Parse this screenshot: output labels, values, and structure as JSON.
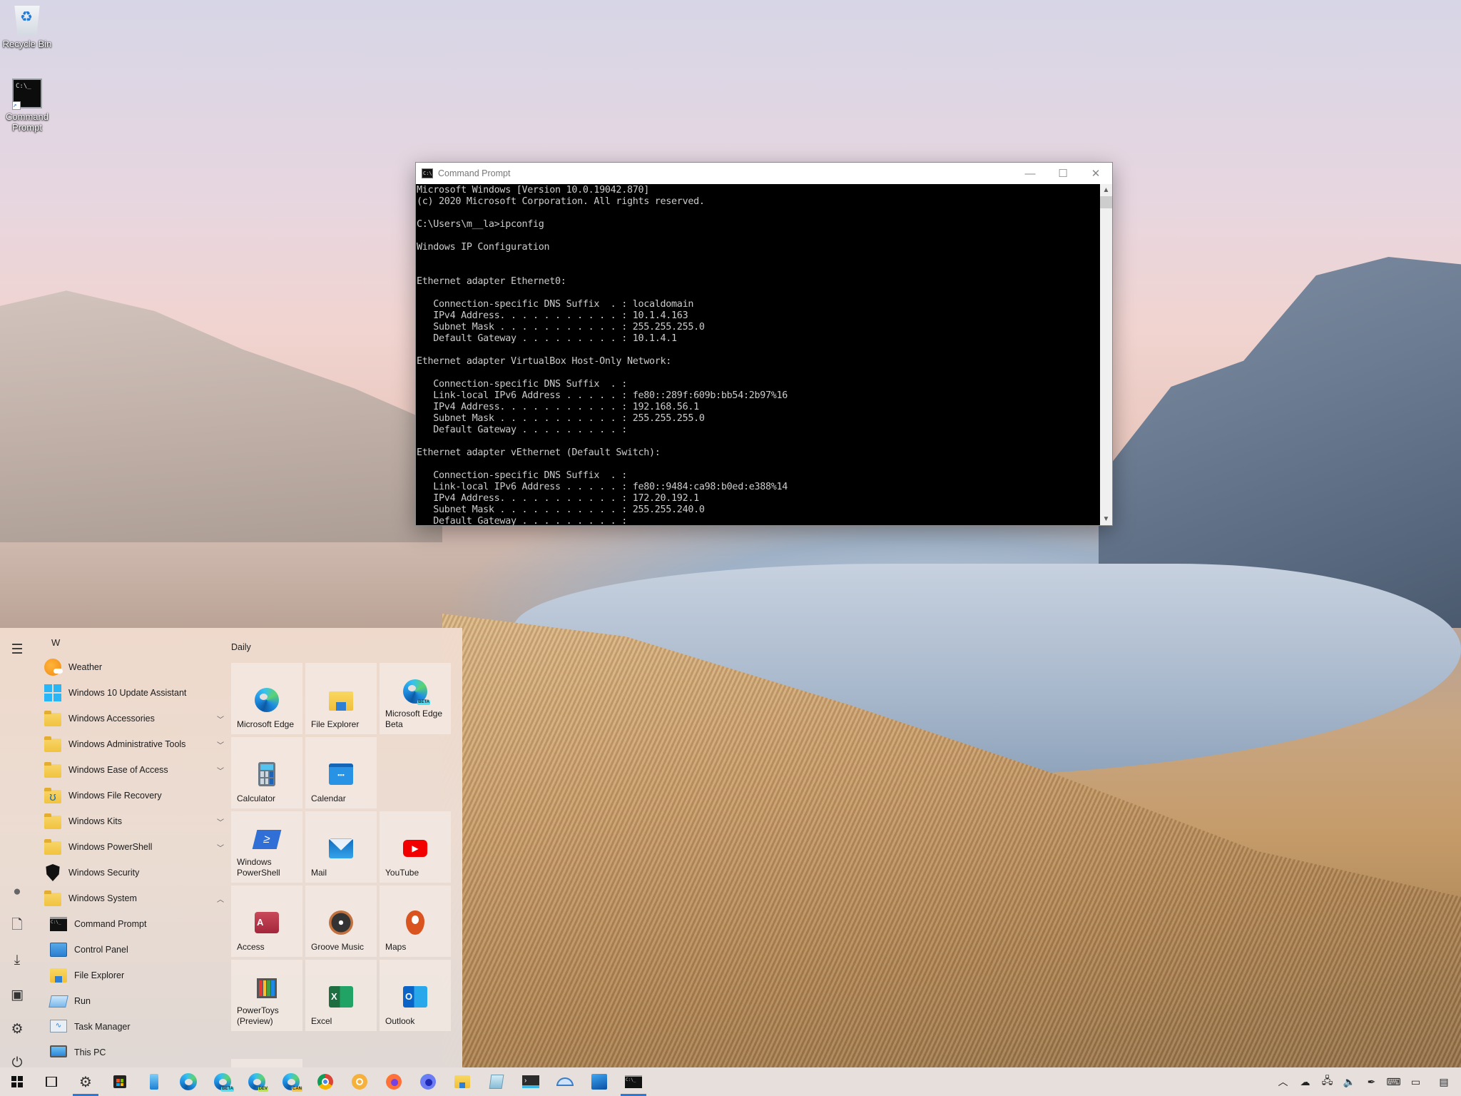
{
  "desktop": {
    "icons": [
      {
        "label": "Recycle Bin",
        "icon": "recycle-bin-icon"
      },
      {
        "label": "Command Prompt",
        "icon": "command-prompt-icon"
      }
    ]
  },
  "cmd_window": {
    "title": "Command Prompt",
    "controls": {
      "minimize": "—",
      "maximize": "☐",
      "close": "✕"
    },
    "scroll_up": "▲",
    "scroll_down": "▼",
    "output": [
      "Microsoft Windows [Version 10.0.19042.870]",
      "(c) 2020 Microsoft Corporation. All rights reserved.",
      "",
      "C:\\Users\\m__la>ipconfig",
      "",
      "Windows IP Configuration",
      "",
      "",
      "Ethernet adapter Ethernet0:",
      "",
      "   Connection-specific DNS Suffix  . : localdomain",
      "   IPv4 Address. . . . . . . . . . . : 10.1.4.163",
      "   Subnet Mask . . . . . . . . . . . : 255.255.255.0",
      "   Default Gateway . . . . . . . . . : 10.1.4.1",
      "",
      "Ethernet adapter VirtualBox Host-Only Network:",
      "",
      "   Connection-specific DNS Suffix  . :",
      "   Link-local IPv6 Address . . . . . : fe80::289f:609b:bb54:2b97%16",
      "   IPv4 Address. . . . . . . . . . . : 192.168.56.1",
      "   Subnet Mask . . . . . . . . . . . : 255.255.255.0",
      "   Default Gateway . . . . . . . . . :",
      "",
      "Ethernet adapter vEthernet (Default Switch):",
      "",
      "   Connection-specific DNS Suffix  . :",
      "   Link-local IPv6 Address . . . . . : fe80::9484:ca98:b0ed:e388%14",
      "   IPv4 Address. . . . . . . . . . . : 172.20.192.1",
      "   Subnet Mask . . . . . . . . . . . : 255.255.240.0",
      "   Default Gateway . . . . . . . . . :"
    ]
  },
  "start_menu": {
    "rail": [
      {
        "name": "menu",
        "glyph": "☰"
      },
      {
        "name": "user-avatar",
        "glyph": "●"
      },
      {
        "name": "documents",
        "glyph": "🗋"
      },
      {
        "name": "downloads",
        "glyph": "⤓"
      },
      {
        "name": "pictures",
        "glyph": "▣"
      },
      {
        "name": "settings",
        "glyph": "⚙"
      },
      {
        "name": "power",
        "glyph": "⏻"
      }
    ],
    "letter": "W",
    "apps": [
      {
        "label": "Weather",
        "icon": "weather",
        "expand": ""
      },
      {
        "label": "Windows 10 Update Assistant",
        "icon": "windows",
        "expand": ""
      },
      {
        "label": "Windows Accessories",
        "icon": "folder",
        "expand": "﹀"
      },
      {
        "label": "Windows Administrative Tools",
        "icon": "folder",
        "expand": "﹀"
      },
      {
        "label": "Windows Ease of Access",
        "icon": "folder",
        "expand": "﹀"
      },
      {
        "label": "Windows File Recovery",
        "icon": "file-recovery",
        "expand": ""
      },
      {
        "label": "Windows Kits",
        "icon": "folder",
        "expand": "﹀"
      },
      {
        "label": "Windows PowerShell",
        "icon": "folder",
        "expand": "﹀"
      },
      {
        "label": "Windows Security",
        "icon": "shield",
        "expand": ""
      },
      {
        "label": "Windows System",
        "icon": "folder",
        "expand": "︿"
      },
      {
        "label": "Command Prompt",
        "icon": "cmd",
        "expand": "",
        "sub": true
      },
      {
        "label": "Control Panel",
        "icon": "control-panel",
        "expand": "",
        "sub": true
      },
      {
        "label": "File Explorer",
        "icon": "file-explorer",
        "expand": "",
        "sub": true
      },
      {
        "label": "Run",
        "icon": "run",
        "expand": "",
        "sub": true
      },
      {
        "label": "Task Manager",
        "icon": "task-manager",
        "expand": "",
        "sub": true
      },
      {
        "label": "This PC",
        "icon": "this-pc",
        "expand": "",
        "sub": true
      }
    ],
    "tiles_group": "Daily",
    "tiles": [
      {
        "label": "Microsoft Edge",
        "icon": "edge"
      },
      {
        "label": "File Explorer",
        "icon": "file-explorer"
      },
      {
        "label": "Microsoft Edge Beta",
        "icon": "edge-beta"
      },
      {
        "label": "Calculator",
        "icon": "calculator"
      },
      {
        "label": "Calendar",
        "icon": "calendar"
      },
      {
        "label": "Windows PowerShell",
        "icon": "powershell"
      },
      {
        "label": "Mail",
        "icon": "mail"
      },
      {
        "label": "YouTube",
        "icon": "youtube"
      },
      {
        "label": "Access",
        "icon": "access"
      },
      {
        "label": "Groove Music",
        "icon": "groove"
      },
      {
        "label": "Maps",
        "icon": "maps"
      },
      {
        "label": "PowerToys (Preview)",
        "icon": "powertoys"
      },
      {
        "label": "Excel",
        "icon": "excel"
      },
      {
        "label": "Outlook",
        "icon": "outlook"
      }
    ]
  },
  "taskbar": {
    "items": [
      {
        "name": "start",
        "active": false
      },
      {
        "name": "task-view",
        "active": false
      },
      {
        "name": "settings",
        "active": true
      },
      {
        "name": "microsoft-store",
        "active": false
      },
      {
        "name": "phone",
        "active": false
      },
      {
        "name": "edge",
        "active": false
      },
      {
        "name": "edge-beta",
        "active": false,
        "badge": "BETA"
      },
      {
        "name": "edge-dev",
        "active": false,
        "badge": "DEV"
      },
      {
        "name": "edge-canary",
        "active": false,
        "badge": "CAN"
      },
      {
        "name": "chrome",
        "active": false
      },
      {
        "name": "chrome-canary",
        "active": false
      },
      {
        "name": "firefox",
        "active": false
      },
      {
        "name": "firefox-nightly",
        "active": false
      },
      {
        "name": "file-explorer",
        "active": false
      },
      {
        "name": "notepad",
        "active": false
      },
      {
        "name": "terminal",
        "active": false
      },
      {
        "name": "protractor",
        "active": false
      },
      {
        "name": "photos",
        "active": false
      },
      {
        "name": "command-prompt",
        "active": true
      }
    ],
    "tray": [
      {
        "name": "show-hidden",
        "glyph": "︿"
      },
      {
        "name": "onedrive",
        "glyph": "☁"
      },
      {
        "name": "network",
        "glyph": "🖧"
      },
      {
        "name": "volume",
        "glyph": "🔈"
      },
      {
        "name": "pen",
        "glyph": "✒"
      },
      {
        "name": "touch-keyboard",
        "glyph": "⌨"
      },
      {
        "name": "touchpad",
        "glyph": "▭"
      },
      {
        "name": "action-center",
        "glyph": "▤"
      }
    ]
  }
}
